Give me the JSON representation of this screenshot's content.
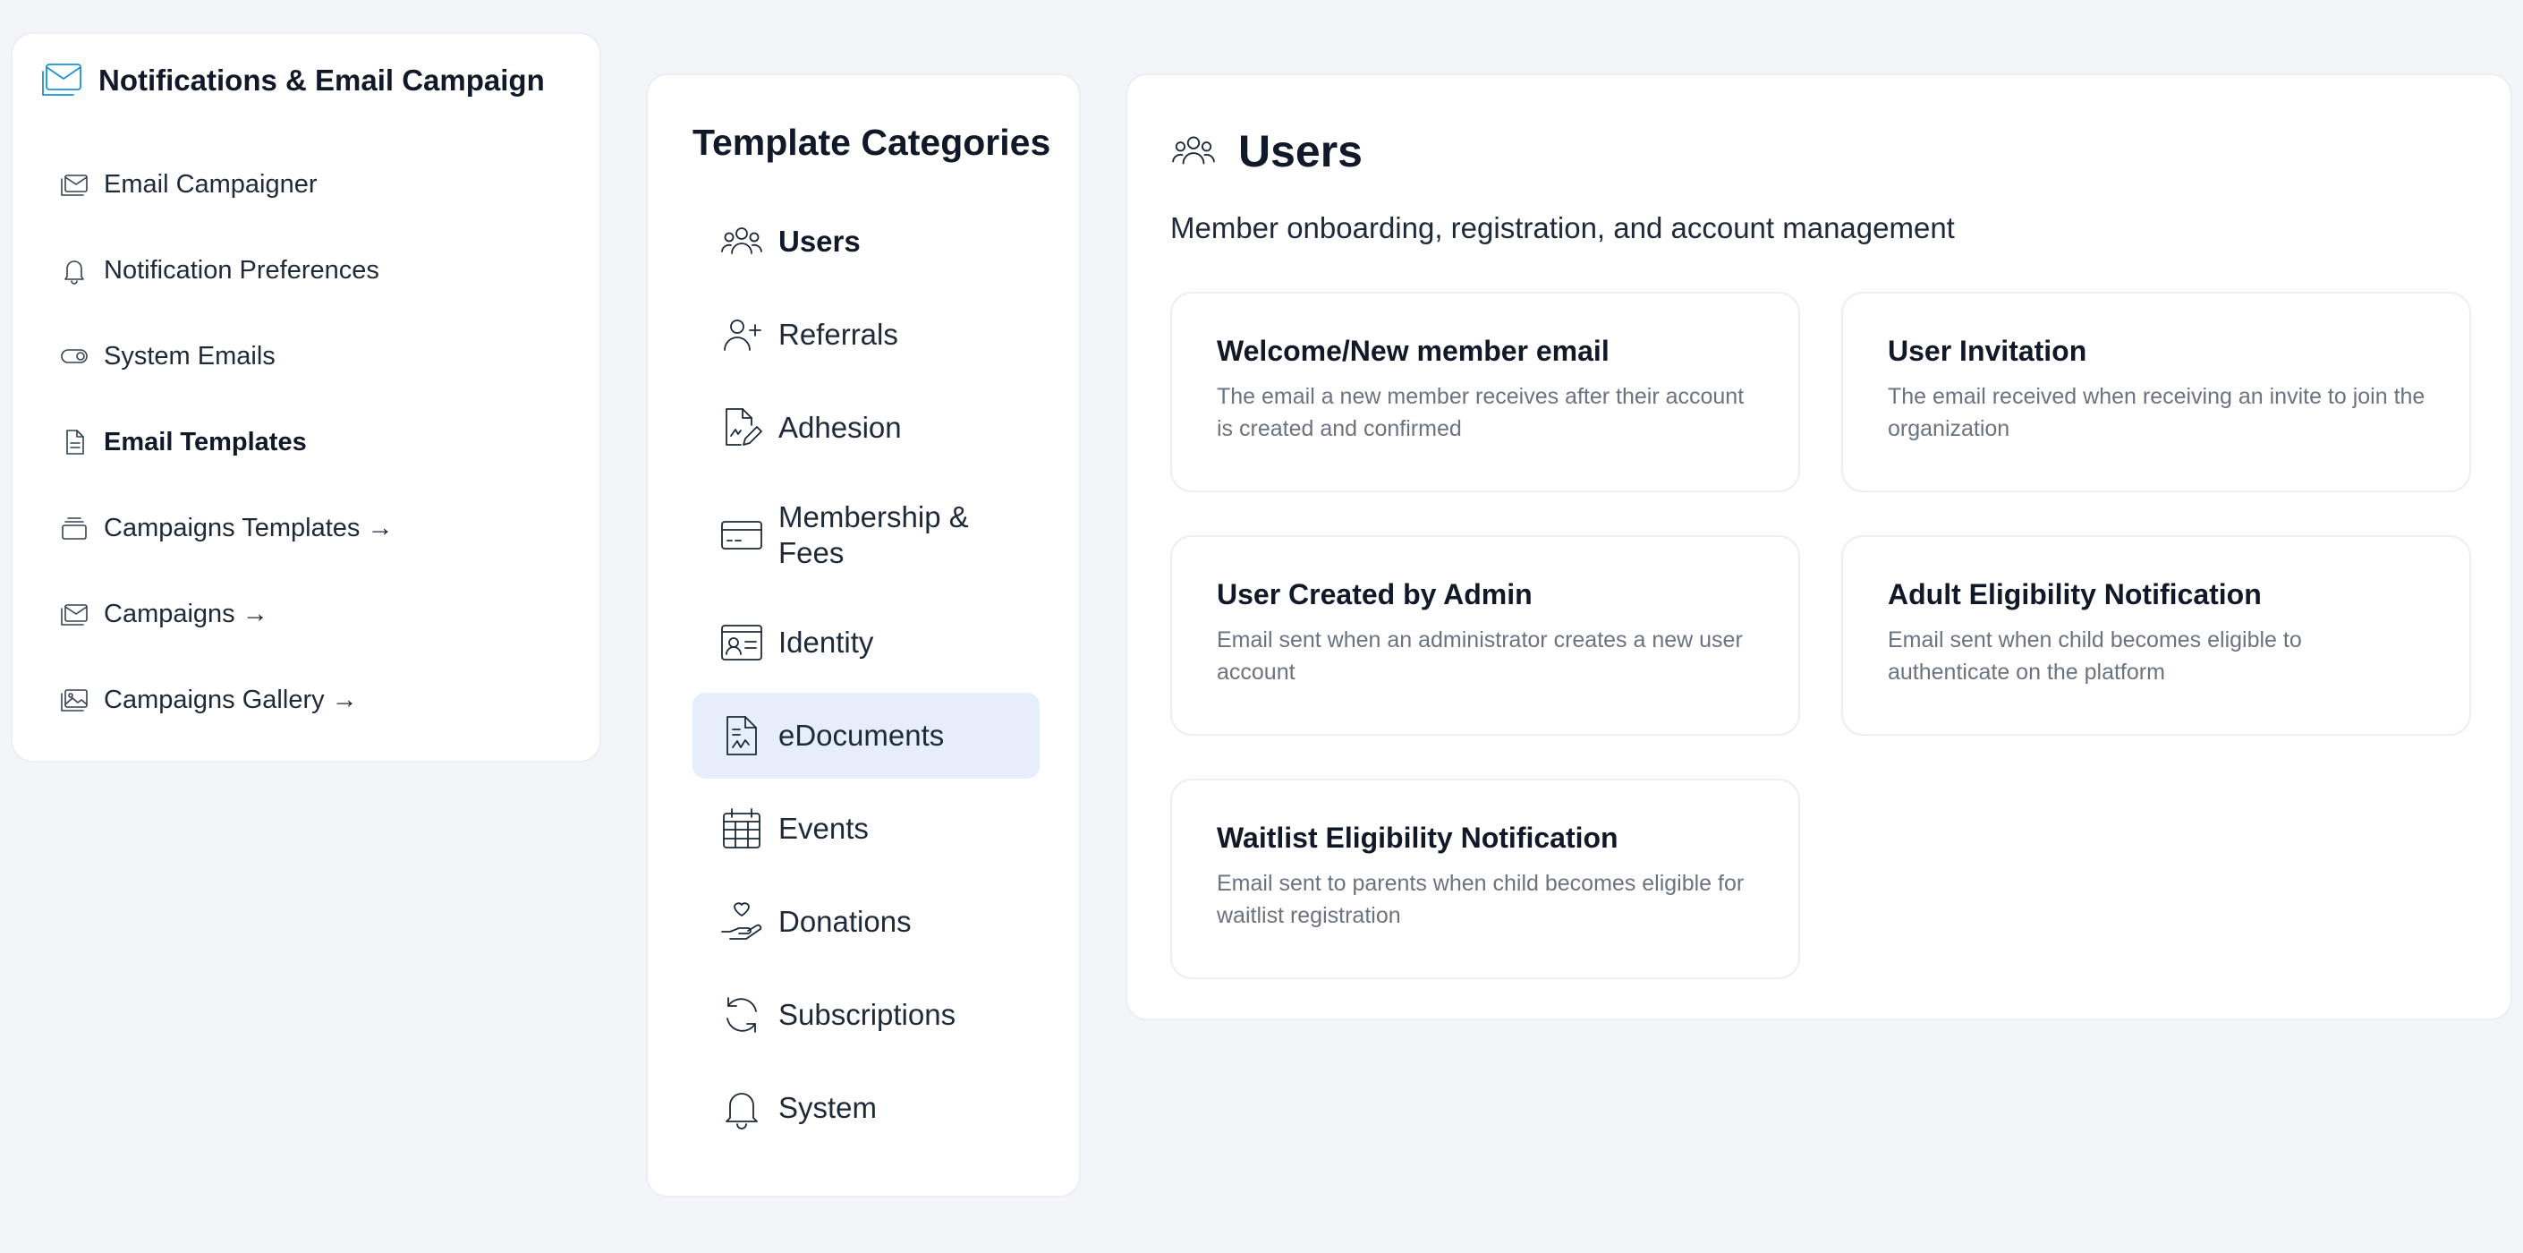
{
  "sidebar": {
    "title": "Notifications & Email Campaign",
    "header_icon": "mail-icon",
    "accent_color": "#1e90d6",
    "items": [
      {
        "label": "Email Campaigner",
        "icon": "mail-stack-icon",
        "active": false
      },
      {
        "label": "Notification Preferences",
        "icon": "bell-icon",
        "active": false
      },
      {
        "label": "System Emails",
        "icon": "toggle-icon",
        "active": false
      },
      {
        "label": "Email Templates",
        "icon": "document-icon",
        "active": true
      },
      {
        "label": "Campaigns Templates →",
        "icon": "stack-icon",
        "active": false
      },
      {
        "label": "Campaigns →",
        "icon": "mail-stack-icon",
        "active": false
      },
      {
        "label": "Campaigns Gallery →",
        "icon": "gallery-icon",
        "active": false
      }
    ]
  },
  "categories": {
    "title": "Template Categories",
    "selected_background": "#e6edfb",
    "items": [
      {
        "label": "Users",
        "icon": "users-icon",
        "bold": true,
        "selected": false
      },
      {
        "label": "Referrals",
        "icon": "user-plus-icon",
        "bold": false,
        "selected": false
      },
      {
        "label": "Adhesion",
        "icon": "document-pen-icon",
        "bold": false,
        "selected": false
      },
      {
        "label": "Membership & Fees",
        "icon": "credit-card-icon",
        "bold": false,
        "selected": false
      },
      {
        "label": "Identity",
        "icon": "id-card-icon",
        "bold": false,
        "selected": false
      },
      {
        "label": "eDocuments",
        "icon": "document-chart-icon",
        "bold": false,
        "selected": true
      },
      {
        "label": "Events",
        "icon": "calendar-icon",
        "bold": false,
        "selected": false
      },
      {
        "label": "Donations",
        "icon": "hand-heart-icon",
        "bold": false,
        "selected": false
      },
      {
        "label": "Subscriptions",
        "icon": "refresh-icon",
        "bold": false,
        "selected": false
      },
      {
        "label": "System",
        "icon": "bell-icon",
        "bold": false,
        "selected": false
      }
    ]
  },
  "main": {
    "icon": "users-icon",
    "title": "Users",
    "description": "Member onboarding, registration, and account management",
    "cards": [
      {
        "title": "Welcome/New member email",
        "description": "The email a new member receives after their account is created and confirmed"
      },
      {
        "title": "User Invitation",
        "description": "The email received when receiving an invite to join the organization"
      },
      {
        "title": "User Created by Admin",
        "description": "Email sent when an administrator creates a new user account"
      },
      {
        "title": "Adult Eligibility Notification",
        "description": "Email sent when child becomes eligible to authenticate on the platform"
      },
      {
        "title": "Waitlist Eligibility Notification",
        "description": "Email sent to parents when child becomes eligible for waitlist registration"
      }
    ]
  }
}
